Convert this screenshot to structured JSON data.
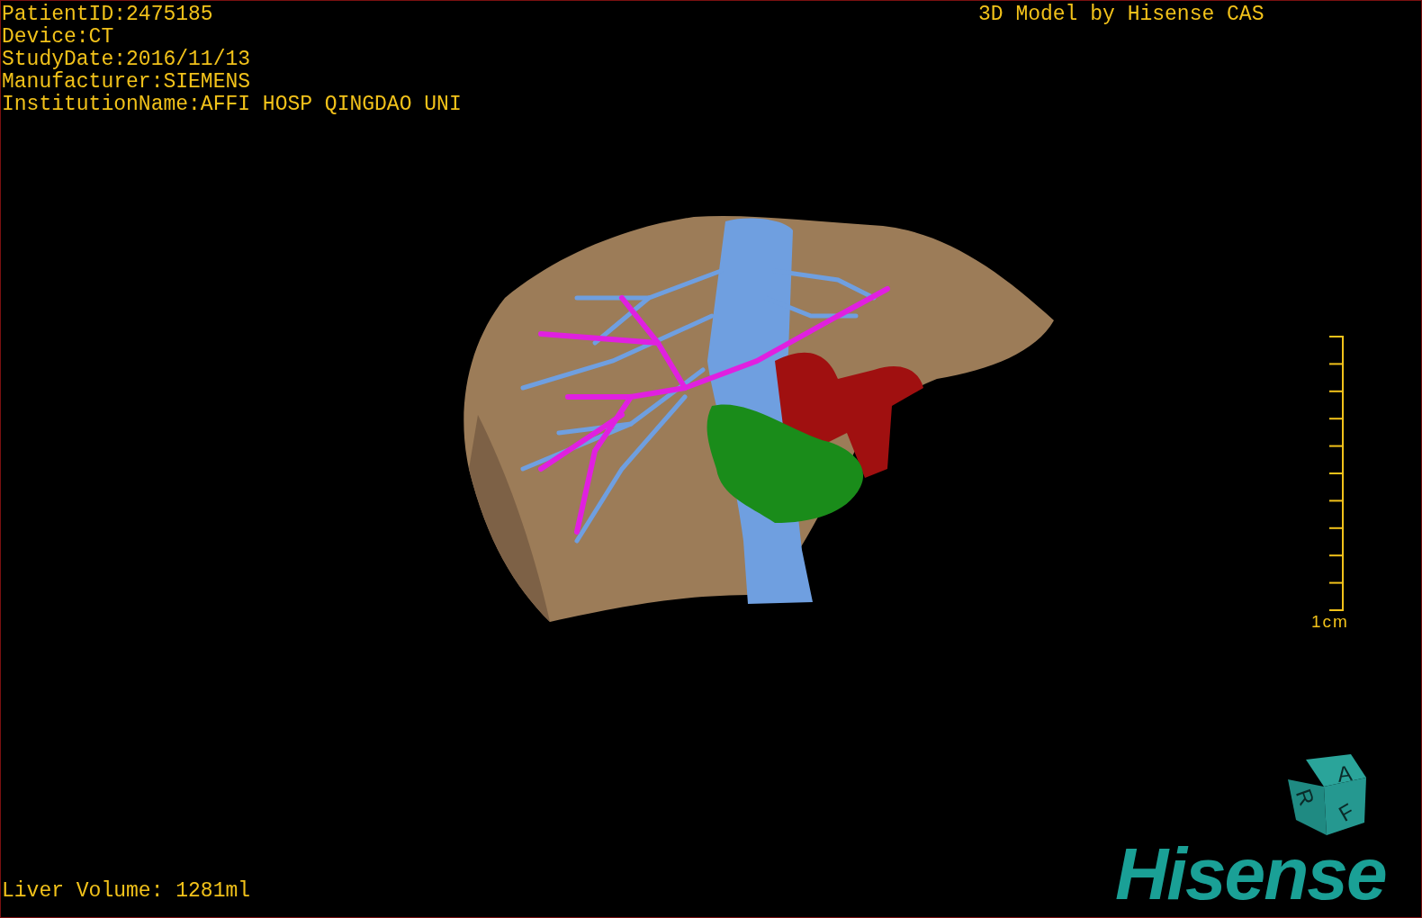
{
  "info_lines": [
    "PatientID:2475185",
    "Device:CT",
    "StudyDate:2016/11/13",
    "Manufacturer:SIEMENS",
    "InstitutionName:AFFI HOSP QINGDAO UNI"
  ],
  "title": "3D Model by Hisense CAS",
  "scale": {
    "label": "1cm"
  },
  "orientation_cube": {
    "faces": [
      "A",
      "R",
      "F"
    ]
  },
  "logo": "Hisense",
  "volume": "Liver Volume: 1281ml"
}
